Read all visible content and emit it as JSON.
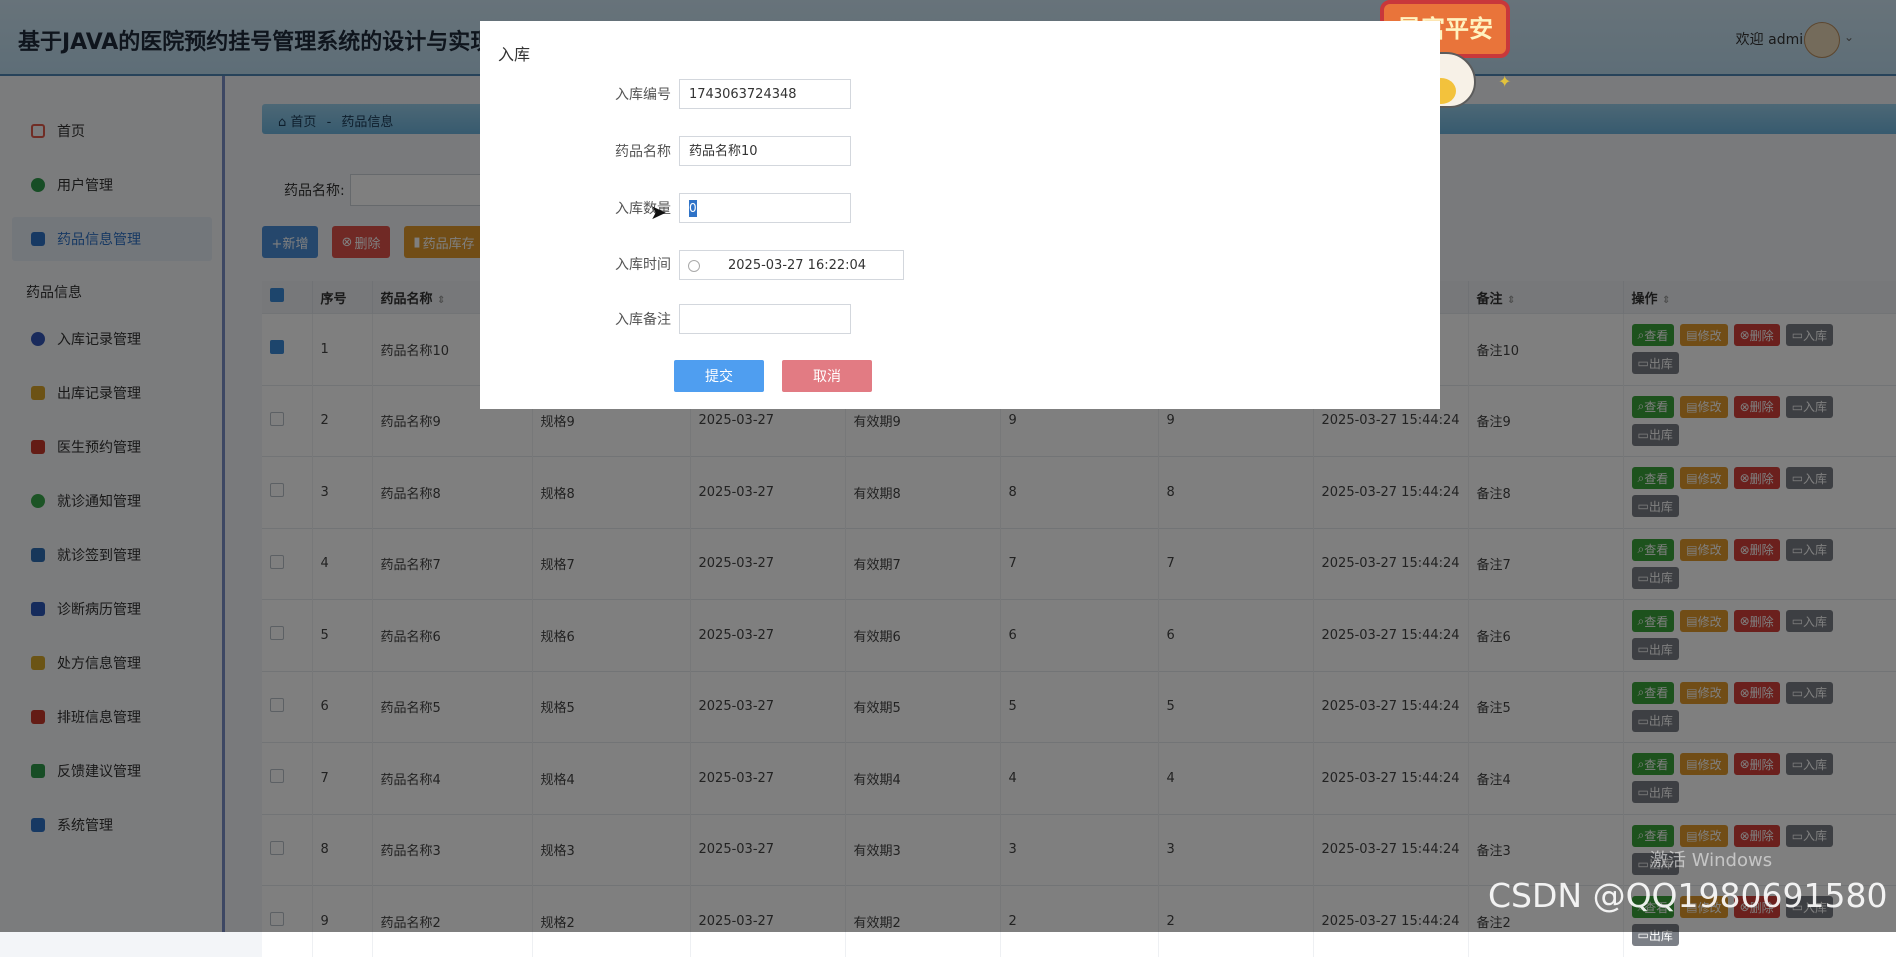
{
  "header": {
    "title": "基于JAVA的医院预约挂号管理系统的设计与实现",
    "welcome": "欢迎 admin"
  },
  "sidebar": {
    "items": [
      {
        "label": "首页",
        "icon": "home-icon",
        "color": "#e05a4a"
      },
      {
        "label": "用户管理",
        "icon": "user-icon",
        "color": "#2f9a4a"
      },
      {
        "label": "药品信息管理",
        "icon": "medicine-icon",
        "color": "#2f73c7",
        "active": true
      },
      {
        "label": "入库记录管理",
        "icon": "inbound-icon",
        "color": "#3457b8"
      },
      {
        "label": "出库记录管理",
        "icon": "outbound-icon",
        "color": "#d9a52a"
      },
      {
        "label": "医生预约管理",
        "icon": "doctor-icon",
        "color": "#c8382a"
      },
      {
        "label": "就诊通知管理",
        "icon": "notice-icon",
        "color": "#39a84a"
      },
      {
        "label": "就诊签到管理",
        "icon": "checkin-icon",
        "color": "#2f6fb5"
      },
      {
        "label": "诊断病历管理",
        "icon": "record-icon",
        "color": "#2a56b8"
      },
      {
        "label": "处方信息管理",
        "icon": "prescription-icon",
        "color": "#d6a82a"
      },
      {
        "label": "排班信息管理",
        "icon": "schedule-icon",
        "color": "#c8382a"
      },
      {
        "label": "反馈建议管理",
        "icon": "feedback-icon",
        "color": "#2f9a4a"
      },
      {
        "label": "系统管理",
        "icon": "system-icon",
        "color": "#2f73c7"
      }
    ],
    "section": "药品信息"
  },
  "breadcrumb": {
    "home": "首页",
    "separator": "-",
    "current": "药品信息"
  },
  "search": {
    "label": "药品名称:",
    "value": ""
  },
  "toolbar": {
    "add": "+新增",
    "delete": "删除",
    "stock": "药品库存"
  },
  "table": {
    "headers": [
      "序号",
      "药品名称",
      "",
      "",
      "",
      "",
      "",
      "",
      "备注",
      "操作"
    ],
    "rows": [
      {
        "no": "1",
        "name": "药品名称10",
        "spec": "",
        "date": "",
        "valid": "",
        "a": "",
        "b": "",
        "time": "",
        "note": "备注10",
        "checked": true
      },
      {
        "no": "2",
        "name": "药品名称9",
        "spec": "规格9",
        "date": "2025-03-27",
        "valid": "有效期9",
        "a": "9",
        "b": "9",
        "time": "2025-03-27 15:44:24",
        "note": "备注9"
      },
      {
        "no": "3",
        "name": "药品名称8",
        "spec": "规格8",
        "date": "2025-03-27",
        "valid": "有效期8",
        "a": "8",
        "b": "8",
        "time": "2025-03-27 15:44:24",
        "note": "备注8"
      },
      {
        "no": "4",
        "name": "药品名称7",
        "spec": "规格7",
        "date": "2025-03-27",
        "valid": "有效期7",
        "a": "7",
        "b": "7",
        "time": "2025-03-27 15:44:24",
        "note": "备注7"
      },
      {
        "no": "5",
        "name": "药品名称6",
        "spec": "规格6",
        "date": "2025-03-27",
        "valid": "有效期6",
        "a": "6",
        "b": "6",
        "time": "2025-03-27 15:44:24",
        "note": "备注6"
      },
      {
        "no": "6",
        "name": "药品名称5",
        "spec": "规格5",
        "date": "2025-03-27",
        "valid": "有效期5",
        "a": "5",
        "b": "5",
        "time": "2025-03-27 15:44:24",
        "note": "备注5"
      },
      {
        "no": "7",
        "name": "药品名称4",
        "spec": "规格4",
        "date": "2025-03-27",
        "valid": "有效期4",
        "a": "4",
        "b": "4",
        "time": "2025-03-27 15:44:24",
        "note": "备注4"
      },
      {
        "no": "8",
        "name": "药品名称3",
        "spec": "规格3",
        "date": "2025-03-27",
        "valid": "有效期3",
        "a": "3",
        "b": "3",
        "time": "2025-03-27 15:44:24",
        "note": "备注3"
      },
      {
        "no": "9",
        "name": "药品名称2",
        "spec": "规格2",
        "date": "2025-03-27",
        "valid": "有效期2",
        "a": "2",
        "b": "2",
        "time": "2025-03-27 15:44:24",
        "note": "备注2"
      }
    ],
    "ops": {
      "view": "查看",
      "edit": "修改",
      "del": "删除",
      "in": "入库",
      "out": "出库"
    }
  },
  "dialog": {
    "title": "入库",
    "fields": {
      "code_label": "入库编号",
      "code_value": "1743063724348",
      "name_label": "药品名称",
      "name_value": "药品名称10",
      "qty_label": "入库数量",
      "qty_value": "0",
      "time_label": "入库时间",
      "time_value": "2025-03-27 16:22:04",
      "note_label": "入库备注",
      "note_value": ""
    },
    "submit": "提交",
    "cancel": "取消"
  },
  "sticker": {
    "text": "暴富平安"
  },
  "watermarks": {
    "windows": "激活 Windows",
    "csdn": "CSDN @QQ1980691580"
  },
  "colors": {
    "primary": "#4f9ef0",
    "cancel": "#e27b83",
    "add": "#4a8fd8",
    "delete": "#e1524a",
    "stock": "#e29b2d"
  }
}
